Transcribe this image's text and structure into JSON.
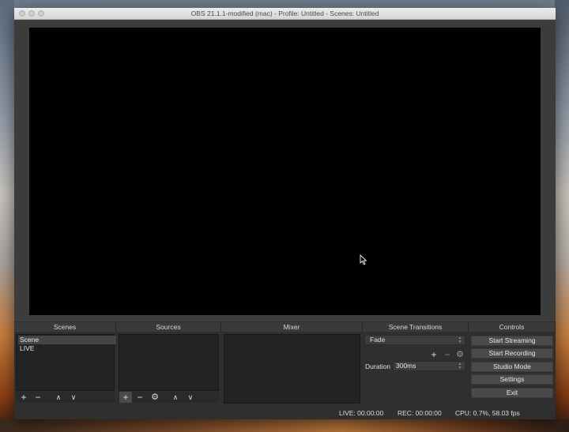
{
  "window": {
    "title": "OBS 21.1.1-modified (mac) - Profile: Untitled - Scenes: Untitled"
  },
  "docks": {
    "scenes": "Scenes",
    "sources": "Sources",
    "mixer": "Mixer",
    "transitions": "Scene Transitions",
    "controls": "Controls"
  },
  "scenes": {
    "items": [
      "Scene",
      "LIVE"
    ],
    "selected": "Scene"
  },
  "toolbar_glyphs": {
    "add": "+",
    "remove": "−",
    "up": "∧",
    "down": "∨",
    "gear": "⚙"
  },
  "transitions": {
    "selected": "Fade",
    "duration_label": "Duration",
    "duration_value": "300ms"
  },
  "controls": {
    "start_streaming": "Start Streaming",
    "start_recording": "Start Recording",
    "studio_mode": "Studio Mode",
    "settings": "Settings",
    "exit": "Exit"
  },
  "status": {
    "live": "LIVE: 00:00:00",
    "rec": "REC: 00:00:00",
    "cpu": "CPU: 0.7%, 58.03 fps"
  },
  "colors": {
    "window_bg": "#2f2f2f",
    "panel_bg": "#232323",
    "button_bg": "#4a4a4a",
    "preview_bg": "#000000"
  }
}
